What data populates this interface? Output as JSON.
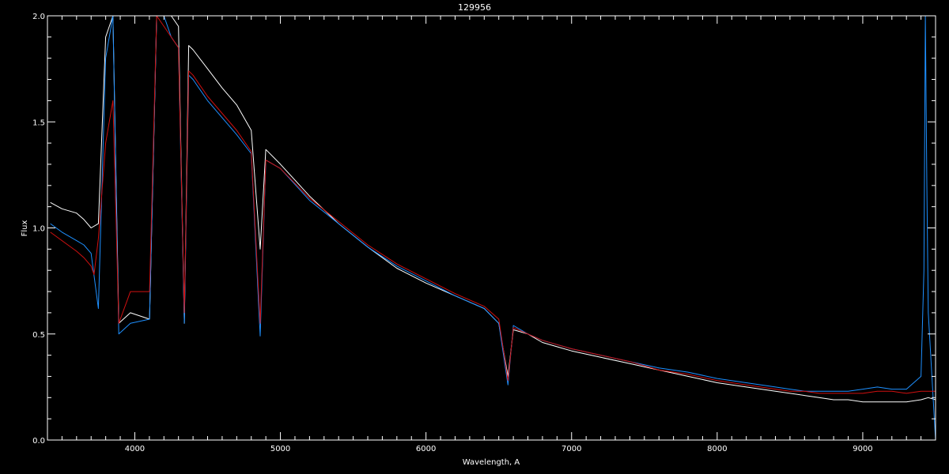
{
  "chart_data": {
    "type": "line",
    "title": "129956",
    "xlabel": "Wavelength, A",
    "ylabel": "Flux",
    "xlim": [
      3400,
      9500
    ],
    "ylim": [
      0.0,
      2.0
    ],
    "x_ticks": [
      4000,
      5000,
      6000,
      7000,
      8000,
      9000
    ],
    "x_tick_labels": [
      "4000",
      "5000",
      "6000",
      "7000",
      "8000",
      "9000"
    ],
    "y_ticks": [
      0.0,
      0.5,
      1.0,
      1.5,
      2.0
    ],
    "y_tick_labels": [
      "0.0",
      "0.5",
      "1.0",
      "1.5",
      "2.0"
    ],
    "grid": false,
    "background": "#000000",
    "axis_color": "#ffffff",
    "series": [
      {
        "color": "#ffffff",
        "x": [
          3420,
          3500,
          3600,
          3650,
          3700,
          3750,
          3800,
          3850,
          3890,
          3970,
          4101,
          4150,
          4200,
          4250,
          4300,
          4340,
          4370,
          4400,
          4500,
          4600,
          4700,
          4800,
          4861,
          4900,
          5000,
          5200,
          5400,
          5600,
          5800,
          6000,
          6200,
          6400,
          6500,
          6563,
          6600,
          6700,
          6800,
          6900,
          7000,
          7200,
          7400,
          7600,
          7800,
          8000,
          8200,
          8400,
          8500,
          8600,
          8700,
          8800,
          8900,
          9000,
          9100,
          9200,
          9300,
          9400,
          9450,
          9500
        ],
        "y": [
          1.12,
          1.09,
          1.07,
          1.04,
          1.0,
          1.02,
          1.9,
          2.1,
          0.55,
          0.6,
          0.57,
          2.1,
          2.1,
          2.0,
          1.95,
          0.55,
          1.86,
          1.84,
          1.75,
          1.66,
          1.58,
          1.46,
          0.9,
          1.37,
          1.3,
          1.15,
          1.02,
          0.91,
          0.81,
          0.74,
          0.68,
          0.62,
          0.55,
          0.3,
          0.52,
          0.5,
          0.46,
          0.44,
          0.42,
          0.39,
          0.36,
          0.33,
          0.3,
          0.27,
          0.25,
          0.23,
          0.22,
          0.21,
          0.2,
          0.19,
          0.19,
          0.18,
          0.18,
          0.18,
          0.18,
          0.19,
          0.2,
          0.19
        ]
      },
      {
        "color": "#1e90ff",
        "x": [
          3420,
          3500,
          3600,
          3650,
          3700,
          3750,
          3800,
          3850,
          3890,
          3970,
          4101,
          4150,
          4200,
          4250,
          4300,
          4340,
          4370,
          4400,
          4500,
          4600,
          4700,
          4800,
          4861,
          4900,
          5000,
          5200,
          5400,
          5600,
          5800,
          6000,
          6200,
          6400,
          6500,
          6563,
          6600,
          6700,
          6800,
          6900,
          7000,
          7200,
          7400,
          7600,
          7800,
          8000,
          8200,
          8400,
          8500,
          8600,
          8700,
          8800,
          8900,
          9000,
          9100,
          9200,
          9300,
          9400,
          9420,
          9430,
          9440,
          9450,
          9500
        ],
        "y": [
          1.02,
          0.98,
          0.94,
          0.92,
          0.88,
          0.62,
          1.8,
          2.0,
          0.5,
          0.55,
          0.57,
          2.0,
          2.0,
          1.9,
          1.85,
          0.55,
          1.72,
          1.7,
          1.6,
          1.52,
          1.44,
          1.35,
          0.49,
          1.32,
          1.28,
          1.13,
          1.02,
          0.91,
          0.82,
          0.75,
          0.68,
          0.62,
          0.55,
          0.26,
          0.54,
          0.5,
          0.47,
          0.45,
          0.43,
          0.4,
          0.37,
          0.34,
          0.32,
          0.29,
          0.27,
          0.25,
          0.24,
          0.23,
          0.23,
          0.23,
          0.23,
          0.24,
          0.25,
          0.24,
          0.24,
          0.3,
          0.8,
          2.0,
          1.2,
          0.6,
          0.0
        ]
      },
      {
        "color": "#d01010",
        "x": [
          3420,
          3500,
          3600,
          3650,
          3700,
          3720,
          3750,
          3800,
          3850,
          3890,
          3970,
          4101,
          4150,
          4200,
          4250,
          4300,
          4340,
          4370,
          4400,
          4500,
          4600,
          4700,
          4800,
          4861,
          4900,
          5000,
          5200,
          5400,
          5600,
          5800,
          6000,
          6200,
          6400,
          6500,
          6563,
          6600,
          6700,
          6800,
          6900,
          7000,
          7200,
          7400,
          7600,
          7800,
          8000,
          8200,
          8400,
          8500,
          8600,
          8700,
          8800,
          8900,
          9000,
          9100,
          9200,
          9300,
          9400,
          9500
        ],
        "y": [
          0.98,
          0.94,
          0.89,
          0.86,
          0.82,
          0.78,
          0.95,
          1.4,
          1.6,
          0.55,
          0.7,
          0.7,
          2.0,
          1.95,
          1.9,
          1.85,
          0.6,
          1.74,
          1.72,
          1.62,
          1.54,
          1.46,
          1.36,
          0.55,
          1.32,
          1.28,
          1.14,
          1.03,
          0.92,
          0.83,
          0.76,
          0.69,
          0.63,
          0.57,
          0.28,
          0.53,
          0.5,
          0.47,
          0.45,
          0.43,
          0.4,
          0.37,
          0.33,
          0.31,
          0.28,
          0.26,
          0.24,
          0.23,
          0.23,
          0.22,
          0.22,
          0.22,
          0.22,
          0.23,
          0.23,
          0.22,
          0.23,
          0.23
        ]
      }
    ]
  }
}
